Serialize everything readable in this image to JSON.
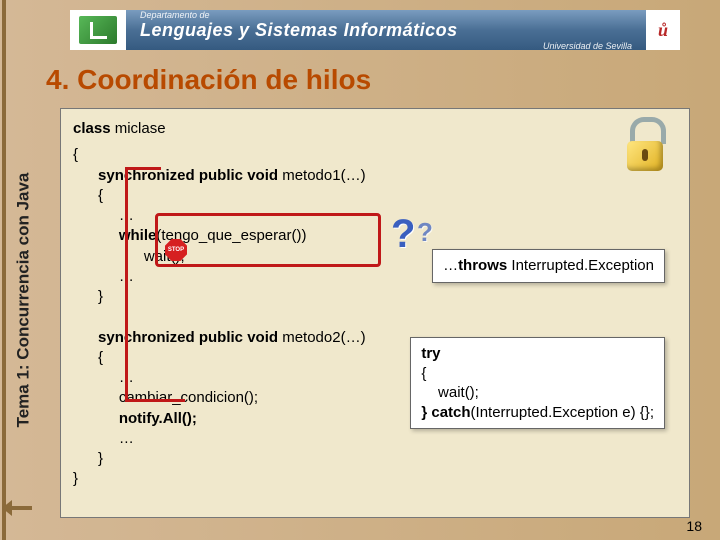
{
  "header": {
    "dept": "Departamento de",
    "title": "Lenguajes y Sistemas Informáticos",
    "univ": "Universidad de Sevilla",
    "us": "ů"
  },
  "section_title": "4. Coordinación de hilos",
  "sidebar_label": "Tema 1: Concurrencia con Java",
  "code": {
    "l01a": "class",
    "l01b": " miclase",
    "l02": "{",
    "l03a": "      synchronized public void",
    "l03b": " metodo1(…)",
    "l04": "      {",
    "l05": "           …",
    "l06a": "           while",
    "l06b": "(tengo_que_esperar())",
    "l07": "                 wait();",
    "l08": "           …",
    "l09": "      }",
    "l10": " ",
    "l11a": "      synchronized public void",
    "l11b": " metodo2(…)",
    "l12": "      {",
    "l13": "           …",
    "l14": "           cambiar_condicion();",
    "l15": "           notify.All();",
    "l16": "           …",
    "l17": "      }",
    "l18": "}"
  },
  "stop_label": "STOP",
  "callout1": "…throws Interrupted.Exception",
  "callout2": {
    "l1a": "try",
    "l2": "{",
    "l3": "    wait();",
    "l4a": "} catch",
    "l4b": "(Interrupted.Exception e) {};"
  },
  "page_number": "18",
  "colors": {
    "accent_orange": "#b84a00",
    "red": "#c01818",
    "code_bg": "#f0e8cc"
  }
}
